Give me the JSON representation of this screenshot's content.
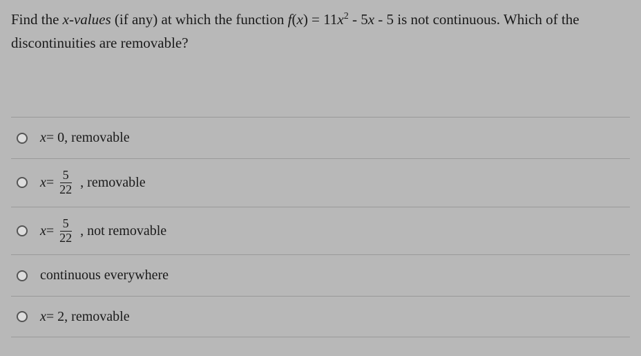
{
  "question": {
    "line1_prefix": "Find the ",
    "xvalues": "x-values",
    "line1_mid": " (if any) at which the function ",
    "func_f": "f",
    "func_open": "(",
    "func_x": "x",
    "func_close": ") = 11",
    "func_x2": "x",
    "func_sq": "2",
    "func_rest": " - 5",
    "func_x3": "x",
    "func_end": " - 5 is not continuous. Which of the",
    "line2": "discontinuities are removable?"
  },
  "options": {
    "opt1": {
      "prefix": "x",
      "rest": " = 0, removable"
    },
    "opt2": {
      "prefix": "x",
      "eq": " = ",
      "num": "5",
      "den": "22",
      "suffix": ", removable"
    },
    "opt3": {
      "prefix": "x",
      "eq": " = ",
      "num": "5",
      "den": "22",
      "suffix": ", not removable"
    },
    "opt4": {
      "text": "continuous everywhere"
    },
    "opt5": {
      "prefix": "x",
      "rest": " = 2, removable"
    }
  }
}
